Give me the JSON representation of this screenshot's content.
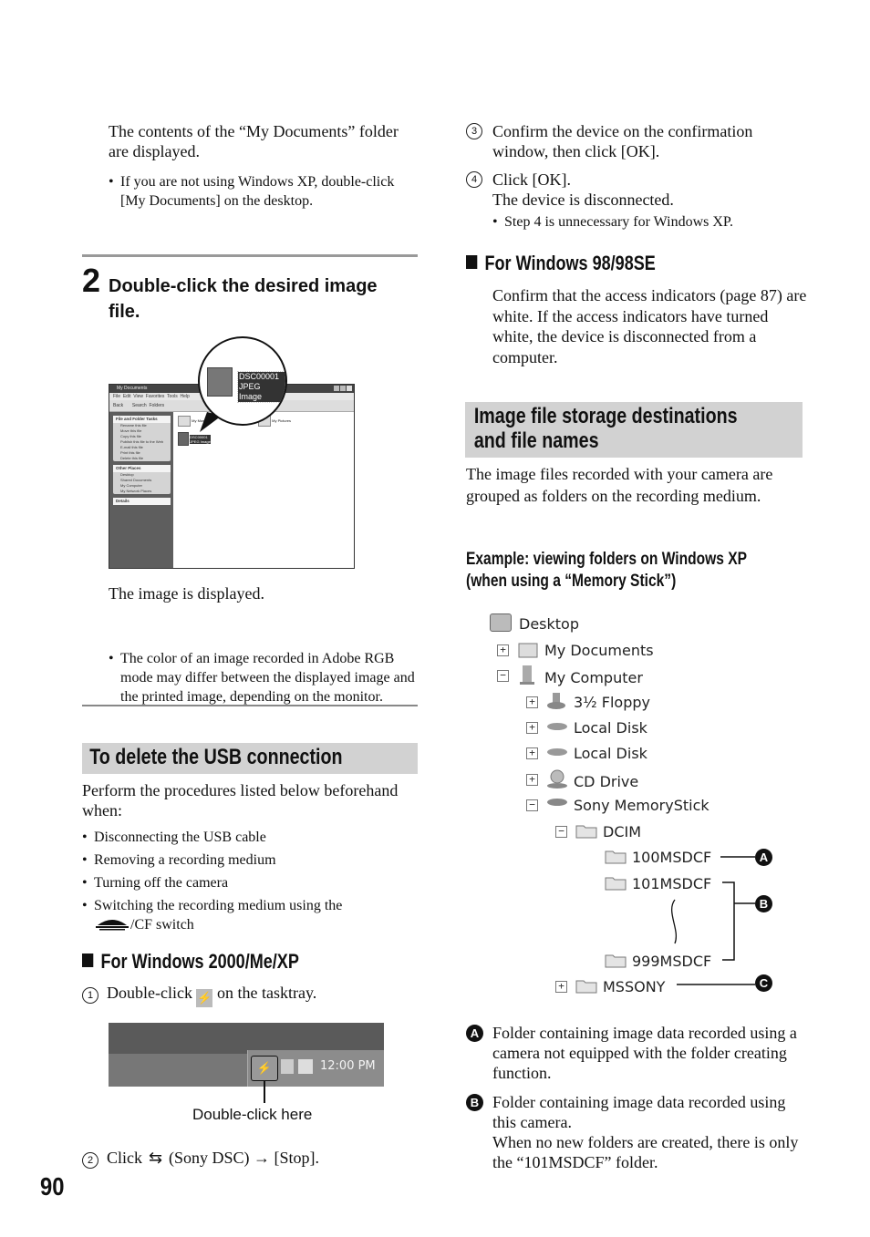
{
  "page_number": "90",
  "left_column": {
    "intro_text": "The contents of the “My Documents” folder are displayed.",
    "intro_note": "If you are not using Windows XP, double-click [My Documents] on the desktop.",
    "step2": {
      "number": "2",
      "title": "Double-click the desired image file."
    },
    "screenshot": {
      "window_title": "My Documents",
      "menu": [
        "File",
        "Edit",
        "View",
        "Favorites",
        "Tools",
        "Help"
      ],
      "toolbar": [
        "Back",
        "Search",
        "Folders"
      ],
      "panels": [
        {
          "title": "File and Folder Tasks",
          "items": [
            "Rename this file",
            "Move this file",
            "Copy this file",
            "Publish this file to the Web",
            "E-mail this file",
            "Print this file",
            "Delete this file"
          ]
        },
        {
          "title": "Other Places",
          "items": [
            "Desktop",
            "Shared Documents",
            "My Computer",
            "My Network Places"
          ]
        },
        {
          "title": "Details",
          "items": []
        }
      ],
      "folders": [
        "My Music",
        "My Pictures"
      ],
      "file_name": "DSC00001",
      "file_type": "JPEG Image"
    },
    "displayed_text": "The image is displayed.",
    "displayed_note": "The color of an image recorded in Adobe RGB mode may differ between the displayed image and the printed image, depending on the monitor.",
    "usb_section": {
      "title": "To delete the USB connection",
      "intro": "Perform the procedures listed below beforehand when:",
      "bullets": [
        "Disconnecting the USB cable",
        "Removing a recording medium",
        "Turning off the camera",
        "Switching the recording medium using the"
      ],
      "switch_suffix": "/CF switch",
      "win2000_heading": "For Windows 2000/Me/XP",
      "step1_prefix": "Double-click",
      "step1_suffix": "on the tasktray.",
      "taskbar_clock": "12:00 PM",
      "callout": "Double-click here",
      "step2_prefix": "Click",
      "step2_suffix": "(Sony DSC) → [Stop]."
    }
  },
  "right_column": {
    "step3": "Confirm the device on the confirmation window, then click [OK].",
    "step4_line1": "Click [OK].",
    "step4_line2": "The device is disconnected.",
    "step4_note": "Step 4 is unnecessary for Windows XP.",
    "win98_heading": "For Windows 98/98SE",
    "win98_text": "Confirm that the access indicators (page 87) are white. If the access indicators have turned white, the device is disconnected from a computer.",
    "storage_section": {
      "title_line1": "Image file storage destinations",
      "title_line2": "and file names",
      "intro": "The image files recorded with your camera are grouped as folders on the recording medium.",
      "example_line1": "Example: viewing folders on Windows XP",
      "example_line2": "(when using a “Memory Stick”)",
      "tree": [
        {
          "label": "Desktop",
          "toggle": ""
        },
        {
          "label": "My Documents",
          "toggle": "+"
        },
        {
          "label": "My Computer",
          "toggle": "−"
        },
        {
          "label": "3½ Floppy",
          "toggle": "+"
        },
        {
          "label": "Local Disk",
          "toggle": "+"
        },
        {
          "label": "Local Disk",
          "toggle": "+"
        },
        {
          "label": "CD Drive",
          "toggle": "+"
        },
        {
          "label": "Sony MemoryStick",
          "toggle": "−"
        },
        {
          "label": "DCIM",
          "toggle": "−"
        },
        {
          "label": "100MSDCF",
          "toggle": ""
        },
        {
          "label": "101MSDCF",
          "toggle": ""
        },
        {
          "label": "999MSDCF",
          "toggle": ""
        },
        {
          "label": "MSSONY",
          "toggle": "+"
        }
      ],
      "markers": [
        "A",
        "B",
        "C"
      ],
      "legend": [
        {
          "marker": "A",
          "text": "Folder containing image data recorded using a camera not equipped with the folder creating function."
        },
        {
          "marker": "B",
          "text": "Folder containing image data recorded using this camera.",
          "extra": "When no new folders are created, there is only the “101MSDCF” folder."
        }
      ]
    }
  }
}
